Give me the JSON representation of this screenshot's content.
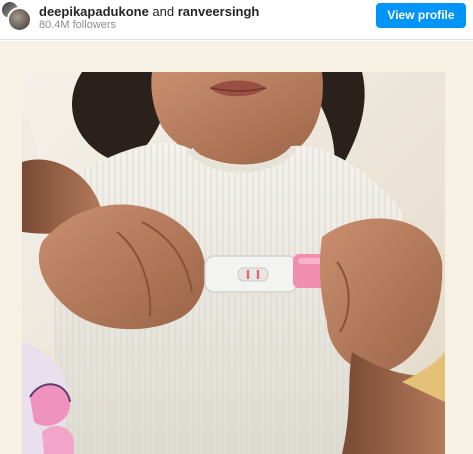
{
  "header": {
    "user_primary": "deepikapadukone",
    "conjunction": " and ",
    "user_secondary": "ranveersingh",
    "followers": "80.4M followers",
    "view_profile_label": "View profile"
  },
  "colors": {
    "accent": "#0095f6",
    "frame_background": "#f7f1e3",
    "test_strip_cap": "#f08fb0"
  },
  "icons": {
    "avatar_primary": "profile-avatar",
    "avatar_secondary": "profile-avatar"
  }
}
